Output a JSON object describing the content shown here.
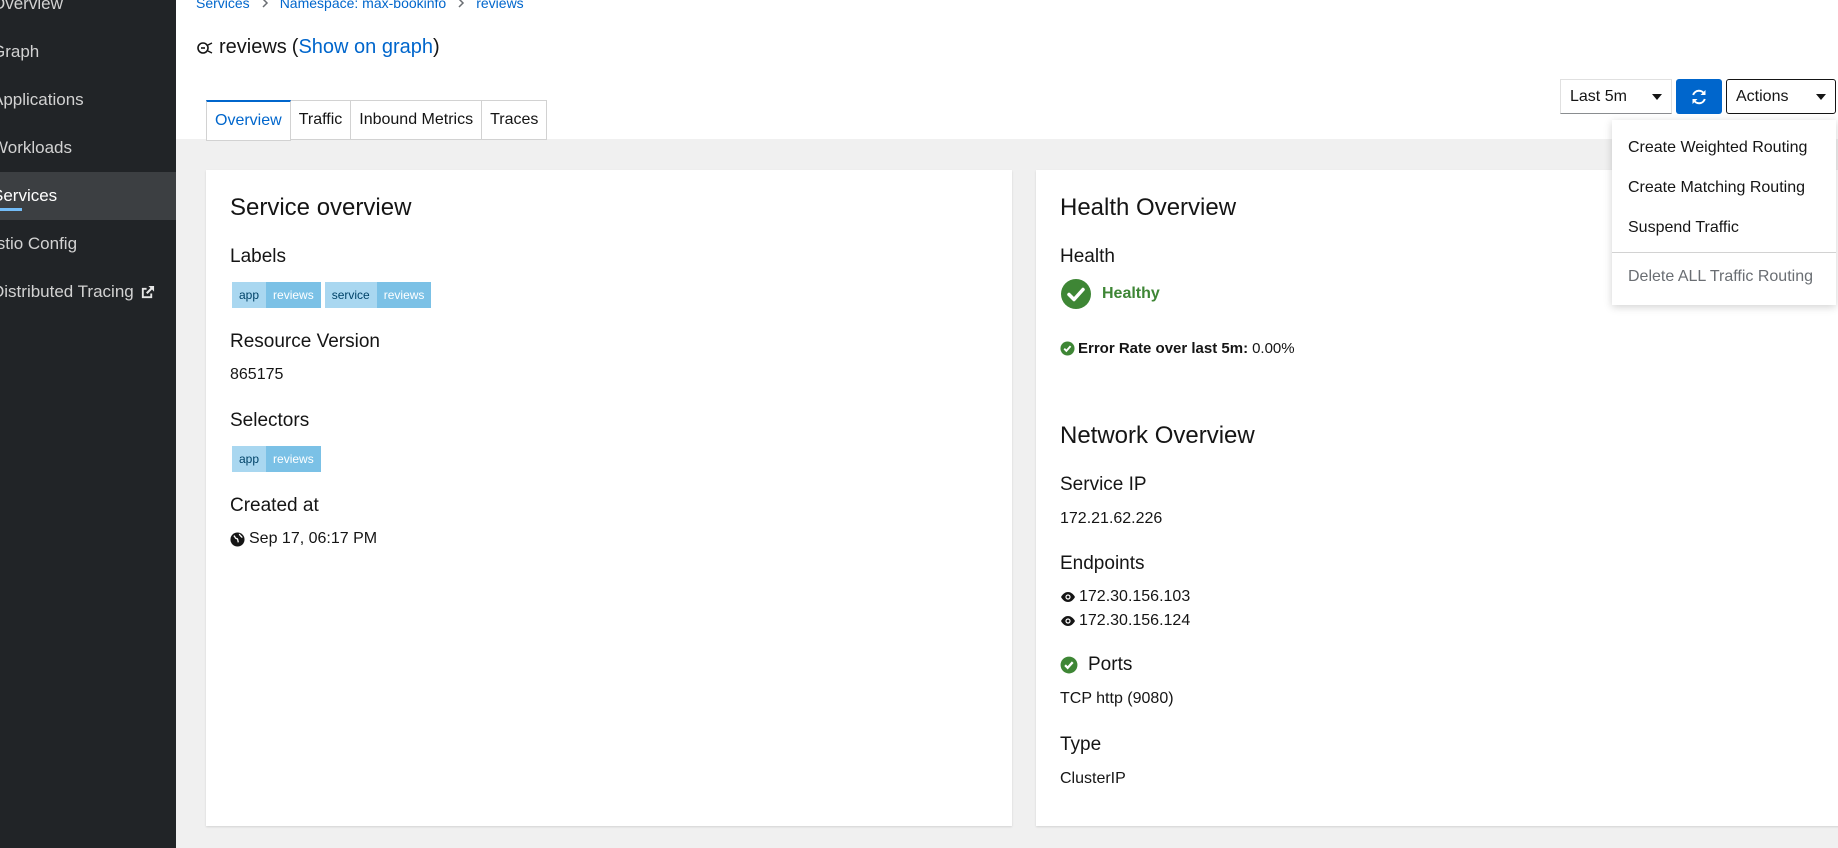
{
  "sidebar": {
    "items": [
      {
        "label": "Overview",
        "active": false
      },
      {
        "label": "Graph",
        "active": false
      },
      {
        "label": "Applications",
        "active": false
      },
      {
        "label": "Workloads",
        "active": false
      },
      {
        "label": "Services",
        "active": true
      },
      {
        "label": "Istio Config",
        "active": false
      },
      {
        "label": "Distributed Tracing",
        "active": false,
        "icon": "external-link-icon"
      }
    ]
  },
  "breadcrumb": [
    "Services",
    "Namespace: max-bookinfo",
    "reviews"
  ],
  "title": {
    "name": "reviews",
    "link": "Show on graph"
  },
  "tabs": [
    "Overview",
    "Traffic",
    "Inbound Metrics",
    "Traces"
  ],
  "toolbar": {
    "time_range": "Last 5m",
    "actions_label": "Actions"
  },
  "actions_menu": {
    "items": [
      "Create Weighted Routing",
      "Create Matching Routing",
      "Suspend Traffic"
    ],
    "disabled_item": "Delete ALL Traffic Routing"
  },
  "service_overview": {
    "title": "Service overview",
    "labels_heading": "Labels",
    "labels": [
      {
        "key": "app",
        "value": "reviews"
      },
      {
        "key": "service",
        "value": "reviews"
      }
    ],
    "resource_version_heading": "Resource Version",
    "resource_version": "865175",
    "selectors_heading": "Selectors",
    "selectors": [
      {
        "key": "app",
        "value": "reviews"
      }
    ],
    "created_heading": "Created at",
    "created": "Sep 17, 06:17 PM"
  },
  "health_overview": {
    "title": "Health Overview",
    "health_heading": "Health",
    "status": "Healthy",
    "error_rate_label": "Error Rate over last 5m:",
    "error_rate_value": "0.00%"
  },
  "network_overview": {
    "title": "Network Overview",
    "service_ip_heading": "Service IP",
    "service_ip": "172.21.62.226",
    "endpoints_heading": "Endpoints",
    "endpoints": [
      "172.30.156.103",
      "172.30.156.124"
    ],
    "ports_heading": "Ports",
    "ports": "TCP http (9080)",
    "type_heading": "Type",
    "type": "ClusterIP"
  },
  "colors": {
    "accent": "#0066cc",
    "healthy": "#3e8635",
    "sidebar": "#212427"
  }
}
